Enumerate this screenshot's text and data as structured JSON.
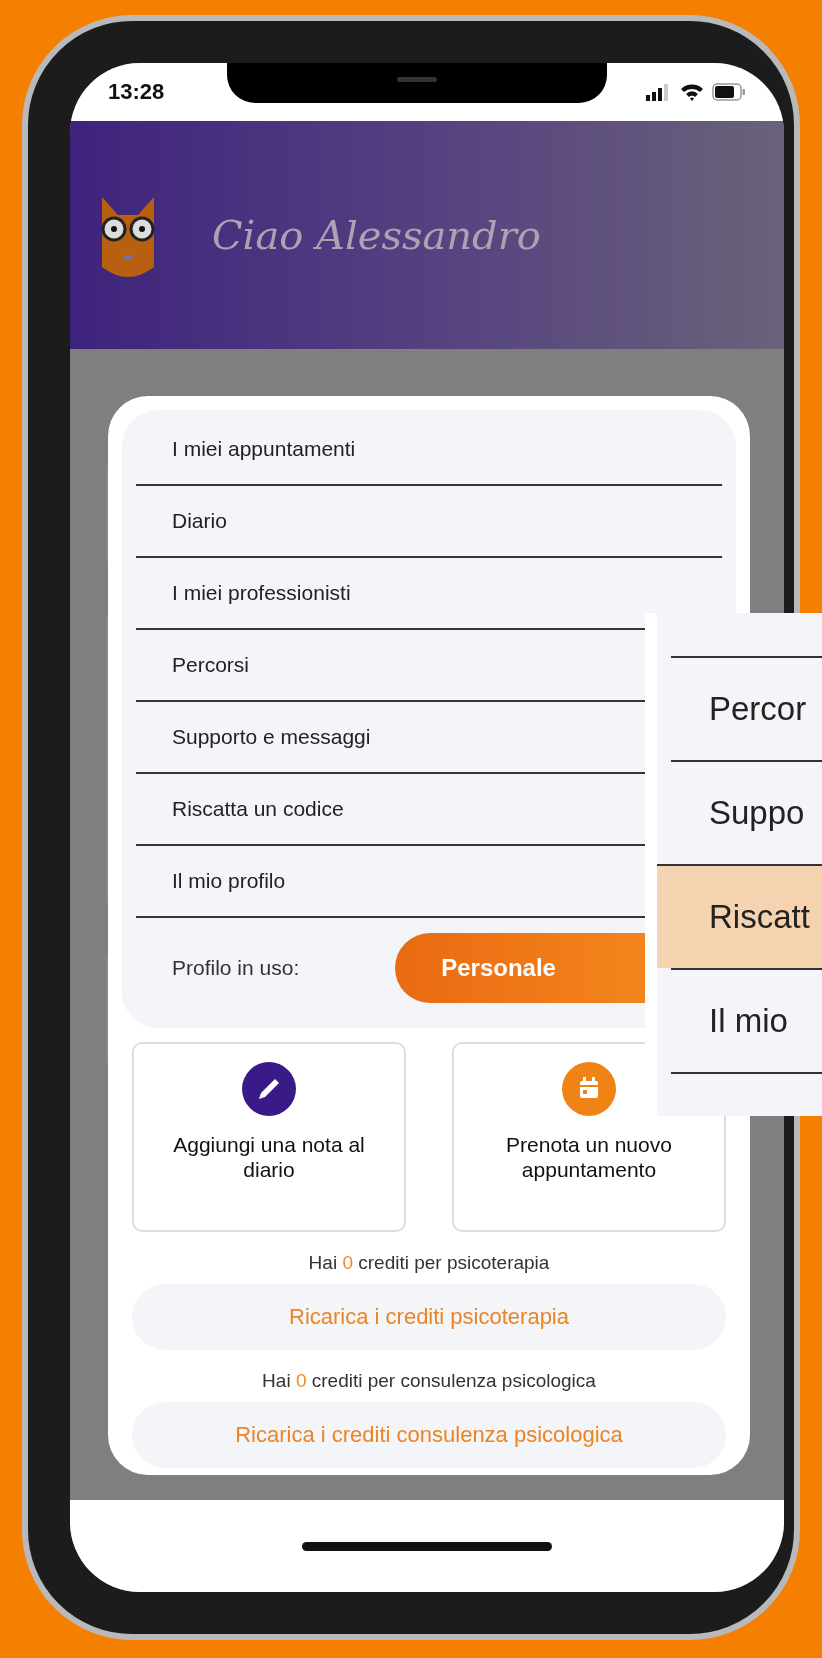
{
  "status_bar": {
    "time": "13:28"
  },
  "header": {
    "greeting": "Ciao Alessandro"
  },
  "menu": {
    "items": [
      {
        "label": "I miei appuntamenti"
      },
      {
        "label": "Diario"
      },
      {
        "label": "I miei professionisti"
      },
      {
        "label": "Percorsi"
      },
      {
        "label": "Supporto e messaggi"
      },
      {
        "label": "Riscatta un codice"
      },
      {
        "label": "Il mio profilo"
      }
    ],
    "profile": {
      "label": "Profilo in uso:",
      "value": "Personale"
    }
  },
  "actions": [
    {
      "kind": "note",
      "label": "Aggiungi una nota al diario"
    },
    {
      "kind": "booking",
      "label": "Prenota un nuovo appuntamento"
    }
  ],
  "credits": [
    {
      "prefix": "Hai",
      "count": "0",
      "suffix": "crediti per psicoterapia",
      "button": "Ricarica i crediti psicoterapia"
    },
    {
      "prefix": "Hai",
      "count": "0",
      "suffix": "crediti per consulenza psicologica",
      "button": "Ricarica i crediti consulenza psicologica"
    }
  ],
  "zoom_inset": {
    "items": [
      {
        "label": "Percor",
        "selected": false
      },
      {
        "label": "Suppo",
        "selected": false
      },
      {
        "label": "Riscatt",
        "selected": true
      },
      {
        "label": "Il mio",
        "selected": false
      }
    ]
  }
}
